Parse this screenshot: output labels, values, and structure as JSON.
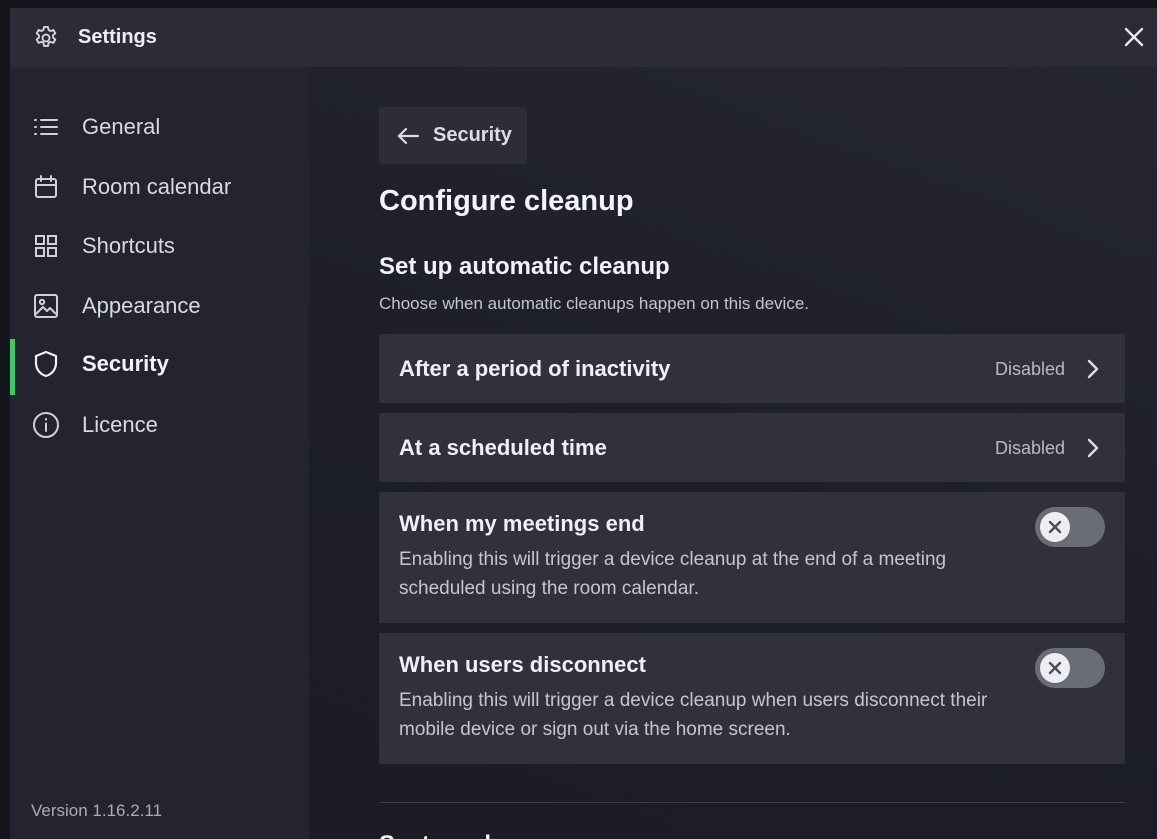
{
  "window": {
    "title": "Settings"
  },
  "sidebar": {
    "items": [
      {
        "label": "General",
        "icon": "list-icon"
      },
      {
        "label": "Room calendar",
        "icon": "calendar-icon"
      },
      {
        "label": "Shortcuts",
        "icon": "grid-icon"
      },
      {
        "label": "Appearance",
        "icon": "image-icon"
      },
      {
        "label": "Security",
        "icon": "shield-icon",
        "active": true
      },
      {
        "label": "Licence",
        "icon": "info-icon"
      }
    ],
    "version": "Version 1.16.2.11"
  },
  "main": {
    "back_label": "Security",
    "page_title": "Configure cleanup",
    "section_title": "Set up automatic cleanup",
    "section_desc": "Choose when automatic cleanups happen on this device.",
    "rows": [
      {
        "label": "After a period of inactivity",
        "status": "Disabled"
      },
      {
        "label": "At a scheduled time",
        "status": "Disabled"
      }
    ],
    "cards": [
      {
        "title": "When my meetings end",
        "body": "Enabling this will trigger a device cleanup at the end of a meeting scheduled using the room calendar.",
        "enabled": false
      },
      {
        "title": "When users disconnect",
        "body": "Enabling this will trigger a device cleanup when users disconnect their mobile device or sign out via the home screen.",
        "enabled": false
      }
    ],
    "next_section_title": "System cleanup"
  },
  "colors": {
    "accent": "#3cc96a",
    "background": "#1e1f29",
    "card": "#30313d"
  }
}
